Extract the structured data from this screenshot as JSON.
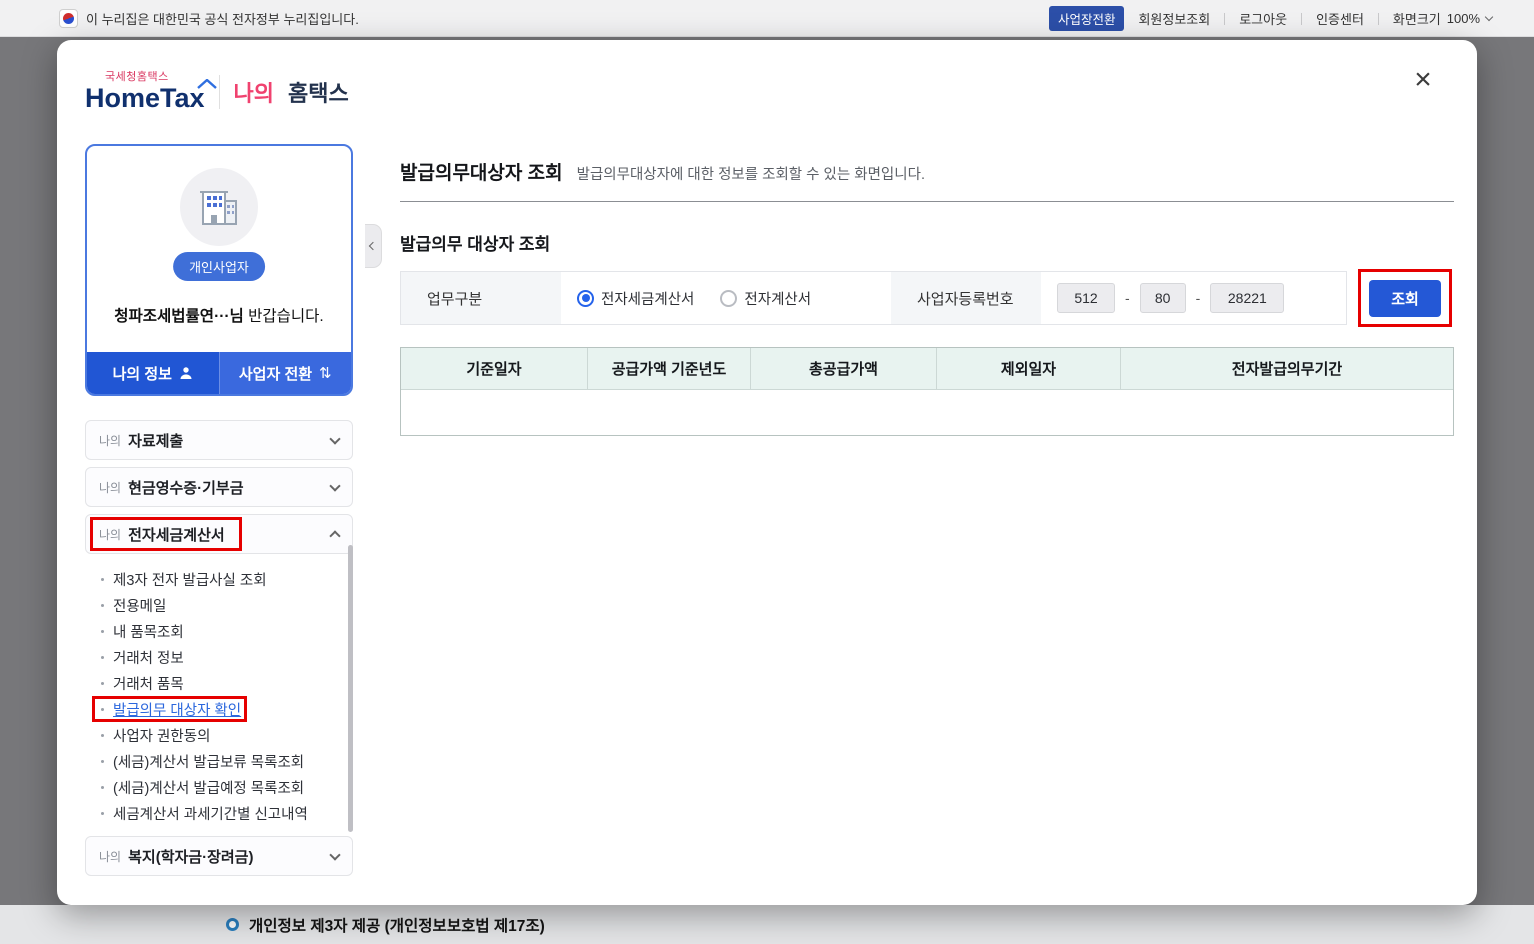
{
  "topbar": {
    "notice": "이 누리집은 대한민국 공식 전자정부 누리집입니다.",
    "badge": "사업장전환",
    "links": [
      "회원정보조회",
      "로그아웃",
      "인증센터"
    ],
    "screen_size_label": "화면크기",
    "screen_size_value": "100%"
  },
  "modal": {
    "logo_small": "국세청홈택스",
    "logo_main": "HomeTax",
    "logo_my": "나의",
    "logo_suffix": "홈택스",
    "close_icon": "×",
    "profile": {
      "type_badge": "개인사업자",
      "greeting_name": "청파조세법률연···님",
      "greeting_rest": " 반갑습니다.",
      "my_info_btn": "나의 정보",
      "switch_btn": "사업자 전환",
      "switch_icon": "⇅"
    },
    "menu": {
      "prefix": "나의",
      "sections": [
        {
          "label": "자료제출"
        },
        {
          "label": "현금영수증·기부금"
        },
        {
          "label": "전자세금계산서"
        },
        {
          "label": "복지(학자금·장려금)"
        }
      ],
      "submenu": [
        "제3자 전자 발급사실 조회",
        "전용메일",
        "내 품목조회",
        "거래처 정보",
        "거래처 품목",
        "발급의무 대상자 확인",
        "사업자 권한동의",
        "(세금)계산서 발급보류 목록조회",
        "(세금)계산서 발급예정 목록조회",
        "세금계산서 과세기간별 신고내역"
      ]
    },
    "content": {
      "page_title": "발급의무대상자 조회",
      "page_desc": "발급의무대상자에 대한 정보를 조회할 수 있는 화면입니다.",
      "section_title": "발급의무 대상자 조회",
      "form": {
        "type_label": "업무구분",
        "radio_etax": "전자세금계산서",
        "radio_ecalc": "전자계산서",
        "bizno_label": "사업자등록번호",
        "bizno_1": "512",
        "bizno_sep": "-",
        "bizno_2": "80",
        "bizno_3": "28221",
        "search_btn": "조회"
      },
      "table_headers": [
        "기준일자",
        "공급가액 기준년도",
        "총공급가액",
        "제외일자",
        "전자발급의무기간"
      ]
    }
  },
  "background_footer": {
    "text": "개인정보 제3자 제공  (개인정보보호법 제17조)"
  },
  "colors": {
    "accent_blue": "#2458d6",
    "highlight_red": "#e60000",
    "logo_pink": "#f0426f",
    "table_header_bg": "#e8f3f0"
  }
}
